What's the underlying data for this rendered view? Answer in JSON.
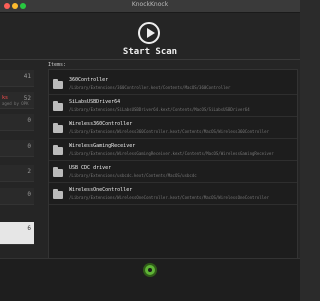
{
  "window": {
    "title": "KnockKnock"
  },
  "toolbar": {
    "scan_label": "Start Scan"
  },
  "items_header": "Items:",
  "sidebar": {
    "items": [
      {
        "count": "41",
        "label": "",
        "sub": ""
      },
      {
        "count": "52",
        "label": "ks",
        "sub": "aged by OPK"
      },
      {
        "count": "0",
        "label": "",
        "sub": ""
      },
      {
        "count": "0",
        "label": "",
        "sub": ""
      },
      {
        "count": "2",
        "label": "",
        "sub": ""
      },
      {
        "count": "0",
        "label": "",
        "sub": ""
      },
      {
        "count": "6",
        "label": "",
        "sub": ""
      }
    ]
  },
  "items": [
    {
      "name": "360Controller",
      "path": "/Library/Extensions/360Controller.kext/Contents/MacOS/360Controller"
    },
    {
      "name": "SiLabsUSBDriver64",
      "path": "/Library/Extensions/SiLabsUSBDriver64.kext/Contents/MacOS/SiLabsUSBDriver64"
    },
    {
      "name": "Wireless360Controller",
      "path": "/Library/Extensions/Wireless360Controller.kext/Contents/MacOS/Wireless360Controller"
    },
    {
      "name": "WirelessGamingReceiver",
      "path": "/Library/Extensions/WirelessGamingReceiver.kext/Contents/MacOS/WirelessGamingReceiver"
    },
    {
      "name": "USB CDC driver",
      "path": "/Library/Extensions/usbcdc.kext/Contents/MacOS/usbcdc"
    },
    {
      "name": "WirelessOneController",
      "path": "/Library/Extensions/WirelessOneController.kext/Contents/MacOS/WirelessOneController"
    }
  ]
}
